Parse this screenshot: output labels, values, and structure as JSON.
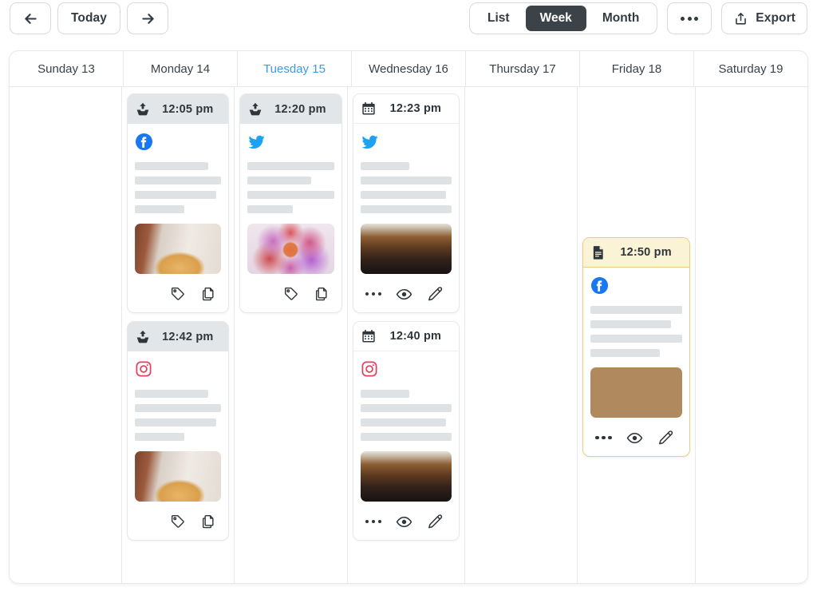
{
  "toolbar": {
    "prev_label": "Previous week",
    "prev_icon": "arrow-left-icon",
    "today_label": "Today",
    "next_label": "Next week",
    "next_icon": "arrow-right-icon",
    "views": [
      {
        "label": "List",
        "active": false
      },
      {
        "label": "Week",
        "active": true
      },
      {
        "label": "Month",
        "active": false
      }
    ],
    "more_label": "More options",
    "more_icon": "ellipsis-icon",
    "export_label": "Export",
    "export_icon": "share-upload-icon",
    "accent_active_bg": "#3b4348",
    "accent_today": "#3d9ae8"
  },
  "calendar": {
    "days": [
      {
        "label": "Sunday 13",
        "today": false
      },
      {
        "label": "Monday 14",
        "today": false
      },
      {
        "label": "Tuesday 15",
        "today": true
      },
      {
        "label": "Wednesday 16",
        "today": false
      },
      {
        "label": "Thursday 17",
        "today": false
      },
      {
        "label": "Friday 18",
        "today": false
      },
      {
        "label": "Saturday 19",
        "today": false
      }
    ],
    "columns": [
      {
        "day": "Sunday 13",
        "posts": []
      },
      {
        "day": "Monday 14",
        "posts": [
          {
            "time": "12:05 pm",
            "header_style": "grey",
            "header_icon": "upload-tray-icon",
            "network": "facebook",
            "network_icon": "facebook-icon",
            "network_color": "#1877F2",
            "skeleton_widths": [
              "85%",
              "100%",
              "94%",
              "57%"
            ],
            "thumbnail": "sandwich-photo",
            "actions": [
              "tag-icon",
              "duplicate-icon"
            ]
          },
          {
            "time": "12:42 pm",
            "header_style": "grey",
            "header_icon": "upload-tray-icon",
            "network": "instagram",
            "network_icon": "instagram-icon",
            "network_color": "#E4405F",
            "skeleton_widths": [
              "85%",
              "100%",
              "94%",
              "57%"
            ],
            "thumbnail": "sandwich-photo",
            "actions": [
              "tag-icon",
              "duplicate-icon"
            ]
          }
        ]
      },
      {
        "day": "Tuesday 15",
        "posts": [
          {
            "time": "12:20 pm",
            "header_style": "grey",
            "header_icon": "upload-tray-icon",
            "network": "twitter",
            "network_icon": "twitter-icon",
            "network_color": "#1DA1F2",
            "skeleton_widths": [
              "100%",
              "74%",
              "100%",
              "52%"
            ],
            "thumbnail": "flowers-photo",
            "actions": [
              "tag-icon",
              "duplicate-icon"
            ]
          }
        ]
      },
      {
        "day": "Wednesday 16",
        "posts": [
          {
            "time": "12:23 pm",
            "header_style": "white",
            "header_icon": "calendar-icon",
            "network": "twitter",
            "network_icon": "twitter-icon",
            "network_color": "#1DA1F2",
            "skeleton_widths": [
              "54%",
              "100%",
              "94%",
              "100%"
            ],
            "thumbnail": "coldbrew-photo",
            "actions": [
              "ellipsis-icon",
              "eye-icon",
              "pencil-icon"
            ]
          },
          {
            "time": "12:40 pm",
            "header_style": "white",
            "header_icon": "calendar-icon",
            "network": "instagram",
            "network_icon": "instagram-icon",
            "network_color": "#E4405F",
            "skeleton_widths": [
              "54%",
              "100%",
              "94%",
              "100%"
            ],
            "thumbnail": "coldbrew-photo",
            "actions": [
              "ellipsis-icon",
              "eye-icon",
              "pencil-icon"
            ]
          }
        ]
      },
      {
        "day": "Thursday 17",
        "posts": []
      },
      {
        "day": "Friday 18",
        "posts": [
          {
            "time": "12:50 pm",
            "header_style": "cream",
            "header_icon": "document-icon",
            "highlighted": true,
            "highlight_color": "#e8cf7e",
            "network": "facebook",
            "network_icon": "facebook-icon",
            "network_color": "#1877F2",
            "skeleton_widths": [
              "100%",
              "88%",
              "100%",
              "76%"
            ],
            "thumbnail": "latte-photo",
            "actions": [
              "ellipsis-icon",
              "eye-icon",
              "pencil-icon"
            ]
          }
        ]
      },
      {
        "day": "Saturday 19",
        "posts": []
      }
    ]
  }
}
